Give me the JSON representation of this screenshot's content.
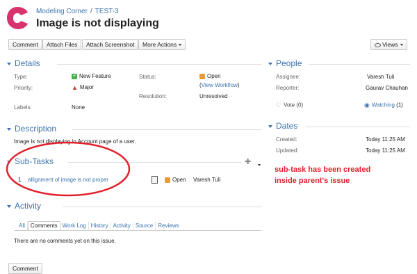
{
  "breadcrumb": {
    "project": "Modeling Corner",
    "separator": "/",
    "issue_key": "TEST-3"
  },
  "issue_title": "Image is not displaying",
  "toolbar": {
    "comment": "Comment",
    "attach_files": "Attach Files",
    "attach_screenshot": "Attach Screenshot",
    "more_actions": "More Actions",
    "views": "Views"
  },
  "details": {
    "heading": "Details",
    "type_label": "Type:",
    "type_value": "New Feature",
    "priority_label": "Priority:",
    "priority_value": "Major",
    "labels_label": "Labels:",
    "labels_value": "None",
    "status_label": "Status:",
    "status_value": "Open",
    "view_workflow_open": "(",
    "view_workflow": "View Workflow",
    "view_workflow_close": ")",
    "resolution_label": "Resolution:",
    "resolution_value": "Unresolved"
  },
  "description": {
    "heading": "Description",
    "text": "Image is not displaying in Account page of a user."
  },
  "subtasks": {
    "heading": "Sub-Tasks",
    "items": [
      {
        "number": "1.",
        "summary": "allignment of image is not proper",
        "status": "Open",
        "assignee": "Varesh Tuli"
      }
    ]
  },
  "activity": {
    "heading": "Activity",
    "tabs": [
      "All",
      "Comments",
      "Work Log",
      "History",
      "Activity",
      "Source",
      "Reviews"
    ],
    "active_tab": "Comments",
    "empty_text": "There are no comments yet on this issue."
  },
  "people": {
    "heading": "People",
    "assignee_label": "Assignee:",
    "assignee_value": "Varesh Tuli",
    "reporter_label": "Reporter:",
    "reporter_value": "Gaurav Chauhan",
    "vote_label": "Vote",
    "vote_count": "(0)",
    "watching_label": "Watching",
    "watching_count": "(1)"
  },
  "dates": {
    "heading": "Dates",
    "created_label": "Created:",
    "created_value": "Today 11:25 AM",
    "updated_label": "Updated:",
    "updated_value": "Today 11:25 AM"
  },
  "annotation": {
    "line1": "sub-task has been created",
    "line2": "inside parent's issue",
    "color": "#e2202c"
  },
  "bottom_button": "Comment",
  "colors": {
    "link": "#3b73af",
    "logo": "#d9336f"
  }
}
